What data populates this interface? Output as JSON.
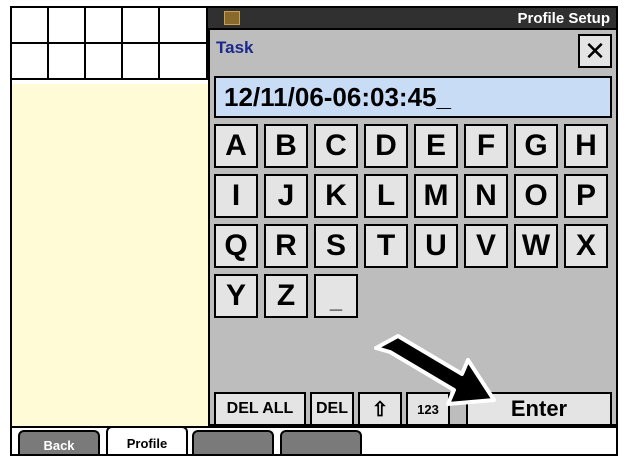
{
  "window": {
    "title": "Profile Setup"
  },
  "dialog": {
    "title": "Task",
    "close_glyph": "✕",
    "entry_value": "12/11/06-06:03:45_"
  },
  "keyboard": {
    "row1": [
      "A",
      "B",
      "C",
      "D",
      "E",
      "F",
      "G",
      "H"
    ],
    "row2": [
      "I",
      "J",
      "K",
      "L",
      "M",
      "N",
      "O",
      "P"
    ],
    "row3": [
      "Q",
      "R",
      "S",
      "T",
      "U",
      "V",
      "W",
      "X"
    ],
    "row4": [
      "Y",
      "Z",
      "_"
    ]
  },
  "buttons": {
    "del_all": "DEL ALL",
    "del": "DEL",
    "shift_glyph": "⇧",
    "numeric": "123",
    "enter": "Enter"
  },
  "tabs": {
    "back": "Back",
    "profile": "Profile"
  }
}
